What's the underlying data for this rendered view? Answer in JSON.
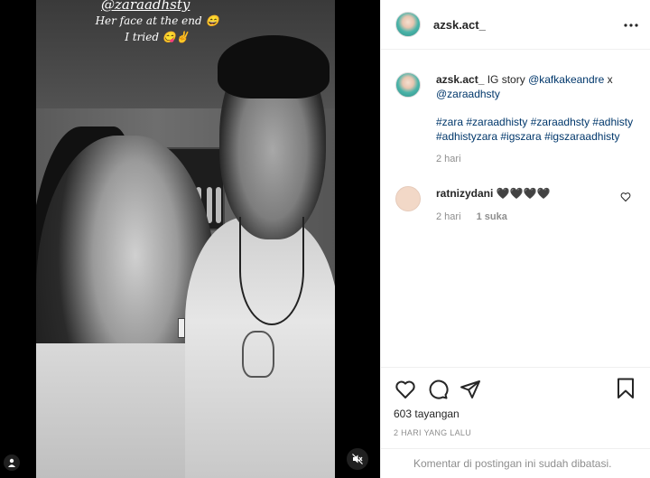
{
  "media": {
    "story_mention": "@zaraadhsty",
    "story_caption_line1": "Her face at the end 😄",
    "story_caption_line2": "I tried 😋✌",
    "mute_icon": "mute-icon",
    "user_tag_icon": "user-icon"
  },
  "header": {
    "username": "azsk.act_",
    "more_icon": "ellipsis-icon"
  },
  "caption": {
    "username": "azsk.act_",
    "text_before": "IG story",
    "mention1": "@kafkakeandre",
    "text_mid": "x",
    "mention2": "@zaraadhsty",
    "hashtags": "#zara #zaraadhisty #zaraadhsty #adhisty #adhistyzara #igszara #igszaraadhisty",
    "time": "2 hari"
  },
  "comment": {
    "username": "ratnizydani",
    "text": "🖤🖤🖤🖤",
    "time": "2 hari",
    "likes": "1 suka"
  },
  "actions": {
    "like_icon": "heart-icon",
    "comment_icon": "comment-icon",
    "share_icon": "share-icon",
    "save_icon": "bookmark-icon",
    "views": "603 tayangan",
    "date": "2 HARI YANG LALU"
  },
  "footer": {
    "text": "Komentar di postingan ini sudah dibatasi."
  }
}
